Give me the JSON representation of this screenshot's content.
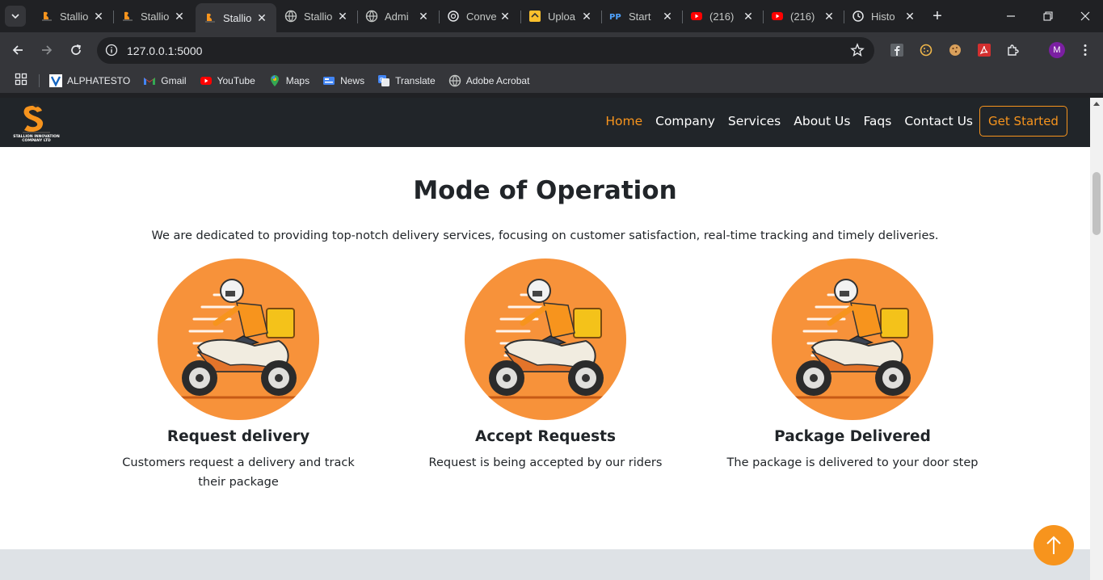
{
  "browser": {
    "tabs": [
      {
        "title": "Stallio",
        "favicon": "stallion-logo-icon",
        "active": false
      },
      {
        "title": "Stallio",
        "favicon": "stallion-logo-icon",
        "active": false
      },
      {
        "title": "Stallio",
        "favicon": "stallion-logo-icon",
        "active": true
      },
      {
        "title": "Stallio",
        "favicon": "globe-icon",
        "active": false
      },
      {
        "title": "Admi",
        "favicon": "globe-icon",
        "active": false
      },
      {
        "title": "Conve",
        "favicon": "chatgpt-icon",
        "active": false
      },
      {
        "title": "Uploa",
        "favicon": "upload-icon",
        "active": false
      },
      {
        "title": "Start",
        "favicon": "pp-icon",
        "active": false
      },
      {
        "title": "(216)",
        "favicon": "youtube-icon",
        "active": false
      },
      {
        "title": "(216)",
        "favicon": "youtube-icon",
        "active": false
      },
      {
        "title": "Histo",
        "favicon": "history-icon",
        "active": false
      }
    ],
    "url": "127.0.0.1:5000",
    "profile_initial": "M",
    "bookmarks": [
      {
        "label": "ALPHATESTO",
        "icon": "alphatesto-icon"
      },
      {
        "label": "Gmail",
        "icon": "gmail-icon"
      },
      {
        "label": "YouTube",
        "icon": "youtube-icon"
      },
      {
        "label": "Maps",
        "icon": "maps-icon"
      },
      {
        "label": "News",
        "icon": "news-icon"
      },
      {
        "label": "Translate",
        "icon": "translate-icon"
      },
      {
        "label": "Adobe Acrobat",
        "icon": "globe-icon"
      }
    ]
  },
  "site": {
    "logo_text": "STALLION INNOVATION COMPANY LTD",
    "nav": [
      "Home",
      "Company",
      "Services",
      "About Us",
      "Faqs",
      "Contact Us"
    ],
    "active_nav": "Home",
    "cta": "Get Started",
    "accent": "#f7941d",
    "header_bg": "#212529"
  },
  "section": {
    "title": "Mode of Operation",
    "subtitle": "We are dedicated to providing top-notch delivery services, focusing on customer satisfaction, real-time tracking and timely deliveries.",
    "cards": [
      {
        "title": "Request delivery",
        "text": "Customers request a delivery and track their package"
      },
      {
        "title": "Accept Requests",
        "text": "Request is being accepted by our riders"
      },
      {
        "title": "Package Delivered",
        "text": "The package is delivered to your door step"
      }
    ]
  }
}
